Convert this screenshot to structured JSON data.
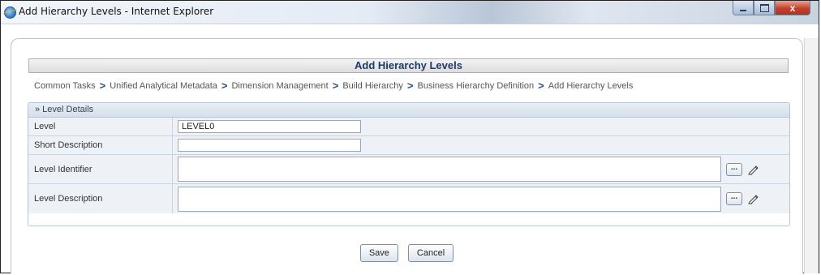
{
  "window": {
    "title": "Add Hierarchy Levels - Internet Explorer",
    "close_glyph": "x"
  },
  "page": {
    "header": "Add Hierarchy Levels",
    "breadcrumb": [
      "Common Tasks",
      "Unified Analytical Metadata",
      "Dimension Management",
      "Build Hierarchy",
      "Business Hierarchy Definition",
      "Add Hierarchy Levels"
    ],
    "breadcrumb_separator": ">"
  },
  "section": {
    "title": "» Level Details",
    "fields": {
      "level": {
        "label": "Level",
        "value": "LEVEL0"
      },
      "short_description": {
        "label": "Short Description",
        "value": ""
      },
      "level_identifier": {
        "label": "Level Identifier",
        "value": ""
      },
      "level_description": {
        "label": "Level Description",
        "value": ""
      }
    },
    "ellipsis_label": "..."
  },
  "buttons": {
    "save": "Save",
    "cancel": "Cancel"
  },
  "colors": {
    "header_text": "#1f3a66",
    "breadcrumb_separator": "#2b4e87",
    "section_bg": "#eef2f7"
  },
  "icons": [
    "ie-icon",
    "minimize-icon",
    "maximize-icon",
    "close-icon",
    "edit-pencil-icon"
  ]
}
